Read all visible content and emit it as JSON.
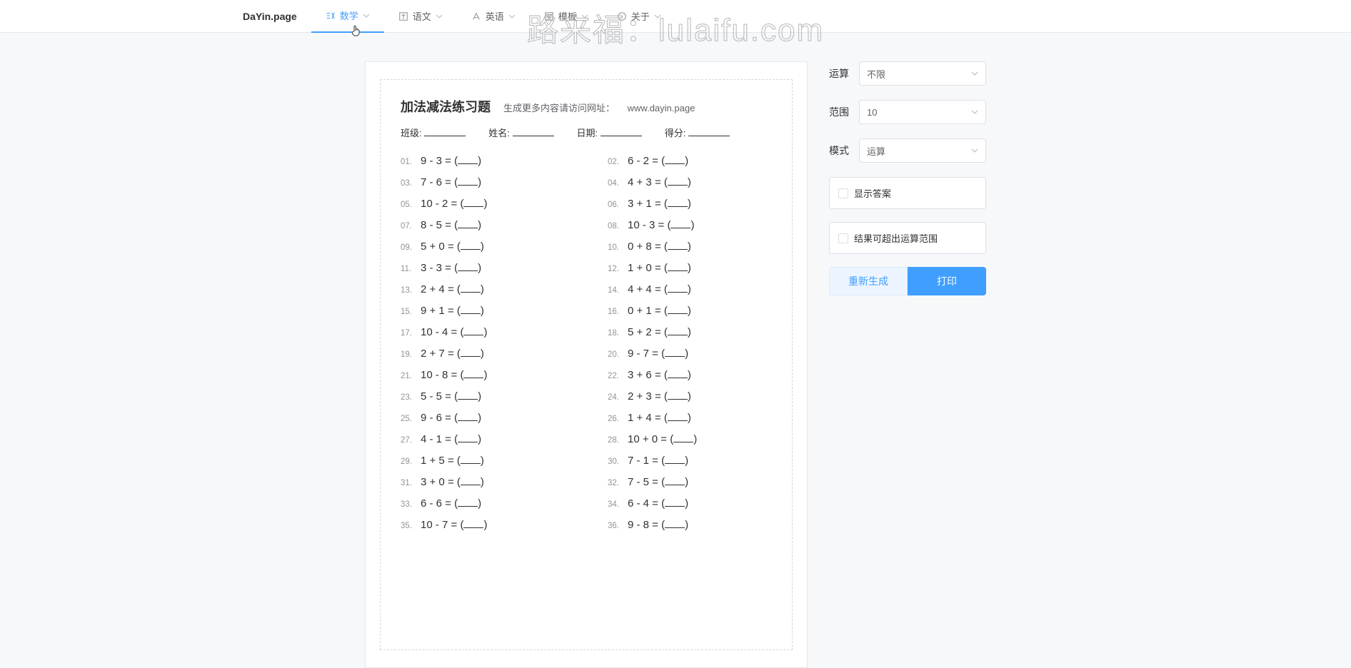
{
  "header": {
    "logo": "DaYin.page",
    "nav": [
      {
        "label": "数学",
        "active": true,
        "key": "math"
      },
      {
        "label": "语文",
        "active": false,
        "key": "chinese",
        "obscured": true
      },
      {
        "label": "英语",
        "active": false,
        "key": "english",
        "obscured": true
      },
      {
        "label": "模板",
        "active": false,
        "key": "template"
      },
      {
        "label": "关于",
        "active": false,
        "key": "about"
      }
    ]
  },
  "watermark": "路来福：lulaifu.com",
  "worksheet": {
    "title": "加法减法练习题",
    "subtitle_prefix": "生成更多内容请访问网址：",
    "subtitle_url": "www.dayin.page",
    "fields": {
      "class": "班级:",
      "name": "姓名:",
      "date": "日期:",
      "score": "得分:"
    },
    "problems": [
      {
        "n": "01.",
        "q": "9 - 3 ="
      },
      {
        "n": "02.",
        "q": "6 - 2 ="
      },
      {
        "n": "03.",
        "q": "7 - 6 ="
      },
      {
        "n": "04.",
        "q": "4 + 3 ="
      },
      {
        "n": "05.",
        "q": "10 - 2 ="
      },
      {
        "n": "06.",
        "q": "3 + 1 ="
      },
      {
        "n": "07.",
        "q": "8 - 5 ="
      },
      {
        "n": "08.",
        "q": "10 - 3 ="
      },
      {
        "n": "09.",
        "q": "5 + 0 ="
      },
      {
        "n": "10.",
        "q": "0 + 8 ="
      },
      {
        "n": "11.",
        "q": "3 - 3 ="
      },
      {
        "n": "12.",
        "q": "1 + 0 ="
      },
      {
        "n": "13.",
        "q": "2 + 4 ="
      },
      {
        "n": "14.",
        "q": "4 + 4 ="
      },
      {
        "n": "15.",
        "q": "9 + 1 ="
      },
      {
        "n": "16.",
        "q": "0 + 1 ="
      },
      {
        "n": "17.",
        "q": "10 - 4 ="
      },
      {
        "n": "18.",
        "q": "5 + 2 ="
      },
      {
        "n": "19.",
        "q": "2 + 7 ="
      },
      {
        "n": "20.",
        "q": "9 - 7 ="
      },
      {
        "n": "21.",
        "q": "10 - 8 ="
      },
      {
        "n": "22.",
        "q": "3 + 6 ="
      },
      {
        "n": "23.",
        "q": "5 - 5 ="
      },
      {
        "n": "24.",
        "q": "2 + 3 ="
      },
      {
        "n": "25.",
        "q": "9 - 6 ="
      },
      {
        "n": "26.",
        "q": "1 + 4 ="
      },
      {
        "n": "27.",
        "q": "4 - 1 ="
      },
      {
        "n": "28.",
        "q": "10 + 0 ="
      },
      {
        "n": "29.",
        "q": "1 + 5 ="
      },
      {
        "n": "30.",
        "q": "7 - 1 ="
      },
      {
        "n": "31.",
        "q": "3 + 0 ="
      },
      {
        "n": "32.",
        "q": "7 - 5 ="
      },
      {
        "n": "33.",
        "q": "6 - 6 ="
      },
      {
        "n": "34.",
        "q": "6 - 4 ="
      },
      {
        "n": "35.",
        "q": "10 - 7 ="
      },
      {
        "n": "36.",
        "q": "9 - 8 ="
      }
    ]
  },
  "sidebar": {
    "operation_label": "运算",
    "operation_value": "不限",
    "range_label": "范围",
    "range_value": "10",
    "mode_label": "模式",
    "mode_value": "运算",
    "show_answers_label": "显示答案",
    "overflow_label": "结果可超出运算范围",
    "regen_btn": "重新生成",
    "print_btn": "打印"
  }
}
